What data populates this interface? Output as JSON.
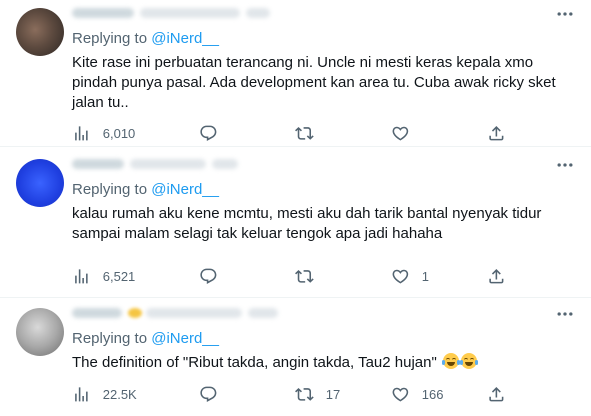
{
  "tweets": [
    {
      "replying_prefix": "Replying to ",
      "replying_handle": "@iNerd__",
      "text": "Kite rase ini perbuatan terancang ni. Uncle ni mesti keras kepala xmo pindah punya pasal. Ada development kan area tu. Cuba awak ricky sket jalan tu..",
      "views": "6,010",
      "replies": "",
      "retweets": "",
      "likes": ""
    },
    {
      "replying_prefix": "Replying to ",
      "replying_handle": "@iNerd__",
      "text": "kalau rumah aku kene mcmtu, mesti aku dah tarik bantal nyenyak tidur sampai malam selagi tak keluar tengok apa jadi hahaha",
      "views": "6,521",
      "replies": "",
      "retweets": "",
      "likes": "1"
    },
    {
      "replying_prefix": "Replying to ",
      "replying_handle": "@iNerd__",
      "text": "The definition of \"Ribut takda, angin takda, Tau2 hujan\" ",
      "views": "22.5K",
      "replies": "",
      "retweets": "17",
      "likes": "166"
    }
  ],
  "icons": {
    "more": "more-icon",
    "views": "views-icon",
    "reply": "reply-icon",
    "retweet": "retweet-icon",
    "like": "like-icon",
    "share": "share-icon",
    "emoji": "tears-of-joy-emoji"
  },
  "colors": {
    "link": "#1d9bf0",
    "secondary_text": "#536471",
    "primary_text": "#0f1419",
    "divider": "#eff3f4"
  }
}
